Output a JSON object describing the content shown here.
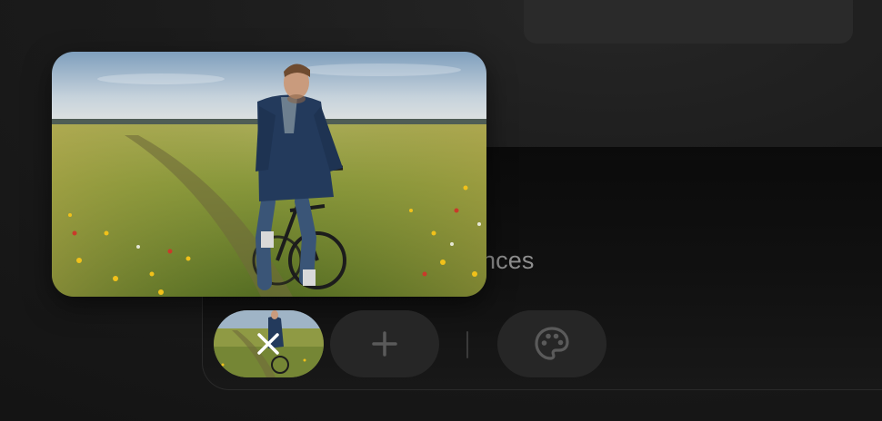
{
  "prompt": {
    "placeholder_visible": "rom text and references"
  },
  "preview": {
    "subject_icon": "reference-image-preview"
  },
  "toolbar": {
    "thumbnail_action_icon": "close-icon",
    "add_icon": "plus-icon",
    "style_icon": "palette-icon"
  },
  "colors": {
    "background": "#161616",
    "panel": "#0b0b0b",
    "pill": "#262626",
    "icon": "#5a5a5a",
    "placeholder_text": "#8e8e8e"
  }
}
